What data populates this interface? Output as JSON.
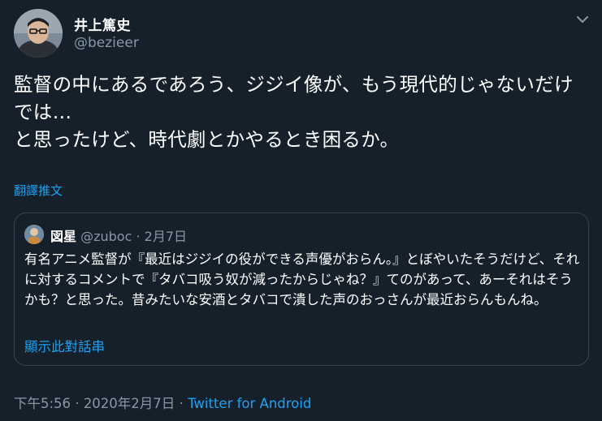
{
  "author": {
    "display_name": "井上篤史",
    "handle": "@bezieer"
  },
  "tweet": {
    "text": "監督の中にあるであろう、ジジイ像が、もう現代的じゃないだけでは…\nと思ったけど、時代劇とかやるとき困るか。",
    "translate_label": "翻譯推文"
  },
  "quoted": {
    "display_name": "図星",
    "handle": "@zuboc",
    "separator": "·",
    "date": "2月7日",
    "text": "有名アニメ監督が『最近はジジイの役ができる声優がおらん。』とぼやいたそうだけど、それに対するコメントで『タバコ吸う奴が減ったからじゃね？』てのがあって、あーそれはそうかも？と思った。昔みたいな安酒とタバコで潰した声のおっさんが最近おらんもんね。",
    "show_thread": "顯示此對話串"
  },
  "meta": {
    "time": "下午5:56",
    "separator1": "·",
    "date": "2020年2月7日",
    "separator2": "·",
    "source": "Twitter for Android"
  },
  "icons": {
    "menu": "chevron-down-icon"
  },
  "colors": {
    "background": "#15202b",
    "link": "#1da1f2",
    "muted": "#8899a6",
    "border": "#38444d"
  }
}
